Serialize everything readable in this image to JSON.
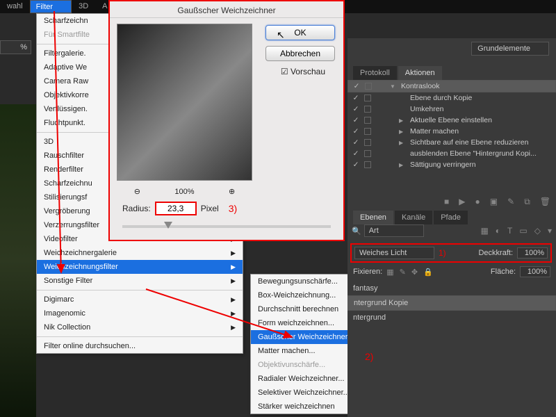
{
  "menubar": {
    "items": [
      "wahl",
      "Filter",
      "3D",
      "A"
    ],
    "activeIndex": 1
  },
  "topLeftPercent": "%",
  "filterMenu": [
    {
      "label": "Scharfzeichn",
      "type": "item"
    },
    {
      "label": "Für Smartfilte",
      "type": "item",
      "disabled": true
    },
    {
      "type": "sep"
    },
    {
      "label": "Filtergalerie.",
      "type": "item"
    },
    {
      "label": "Adaptive We",
      "type": "item"
    },
    {
      "label": "Camera Raw",
      "type": "item"
    },
    {
      "label": "Objektivkorre",
      "type": "item"
    },
    {
      "label": "Verflüssigen.",
      "type": "item"
    },
    {
      "label": "Fluchtpunkt.",
      "type": "item"
    },
    {
      "type": "sep"
    },
    {
      "label": "3D",
      "arrow": true
    },
    {
      "label": "Rauschfilter",
      "arrow": true
    },
    {
      "label": "Renderfilter",
      "arrow": true
    },
    {
      "label": "Scharfzeichnu",
      "arrow": true
    },
    {
      "label": "Stilisierungsf",
      "arrow": true
    },
    {
      "label": "Vergröberung",
      "arrow": true
    },
    {
      "label": "Verzerrungsfilter",
      "arrow": true
    },
    {
      "label": "Videofilter",
      "arrow": true
    },
    {
      "label": "Weichzeichnergalerie",
      "arrow": true
    },
    {
      "label": "Weichzeichnungsfilter",
      "arrow": true,
      "hover": true
    },
    {
      "label": "Sonstige Filter",
      "arrow": true
    },
    {
      "type": "sep"
    },
    {
      "label": "Digimarc",
      "arrow": true
    },
    {
      "label": "Imagenomic",
      "arrow": true
    },
    {
      "label": "Nik Collection",
      "arrow": true
    },
    {
      "type": "sep"
    },
    {
      "label": "Filter online durchsuchen..."
    }
  ],
  "submenu": [
    {
      "label": "Bewegungsunschärfe..."
    },
    {
      "label": "Box-Weichzeichnung..."
    },
    {
      "label": "Durchschnitt berechnen"
    },
    {
      "label": "Form weichzeichnen..."
    },
    {
      "label": "Gaußscher Weichzeichner...",
      "hover": true
    },
    {
      "label": "Matter machen..."
    },
    {
      "label": "Objektivunschärfe...",
      "disabled": true
    },
    {
      "label": "Radialer Weichzeichner..."
    },
    {
      "label": "Selektiver Weichzeichner..."
    },
    {
      "label": "Stärker weichzeichnen"
    }
  ],
  "dialog": {
    "title": "Gaußscher Weichzeichner",
    "ok": "OK",
    "cancel": "Abbrechen",
    "preview_cb": "Vorschau",
    "zoom": "100%",
    "radius_label": "Radius:",
    "radius_value": "23,3",
    "pixel": "Pixel",
    "ann": "3)"
  },
  "annotations": {
    "a1": "1)",
    "a2": "2)"
  },
  "rightTopSelect": "Grundelemente",
  "panelTabs": [
    "Protokoll",
    "Aktionen"
  ],
  "actions": [
    {
      "label": "Kontraslook",
      "sel": true,
      "tri": "▼",
      "indent": 1
    },
    {
      "label": "Ebene durch Kopie",
      "indent": 2
    },
    {
      "label": "Umkehren",
      "indent": 2
    },
    {
      "label": "Aktuelle Ebene einstellen",
      "tri": "▶",
      "indent": 2
    },
    {
      "label": "Matter machen",
      "tri": "▶",
      "indent": 2
    },
    {
      "label": "Sichtbare auf eine Ebene reduzieren",
      "tri": "▶",
      "indent": 2
    },
    {
      "label": "ausblenden Ebene \"Hintergrund Kopi...",
      "indent": 2
    },
    {
      "label": "Sättigung verringern",
      "tri": "▶",
      "indent": 2
    }
  ],
  "actionFooter": [
    "■",
    "▶",
    "●",
    "▣",
    "✎",
    "⧉",
    "🗑"
  ],
  "layerTabs": [
    "Ebenen",
    "Kanäle",
    "Pfade"
  ],
  "search": {
    "placeholder": "Art",
    "icons": [
      "▦",
      "◐",
      "T",
      "▭",
      "◇",
      "▾"
    ]
  },
  "blend": {
    "mode": "Weiches Licht",
    "opacity_label": "Deckkraft:",
    "opacity": "100%"
  },
  "fix": {
    "label": "Fixieren:",
    "fill_label": "Fläche:",
    "fill": "100%"
  },
  "layers": [
    {
      "name": "fantasy"
    },
    {
      "name": "ntergrund Kopie",
      "sel": true
    },
    {
      "name": "ntergrund"
    }
  ]
}
